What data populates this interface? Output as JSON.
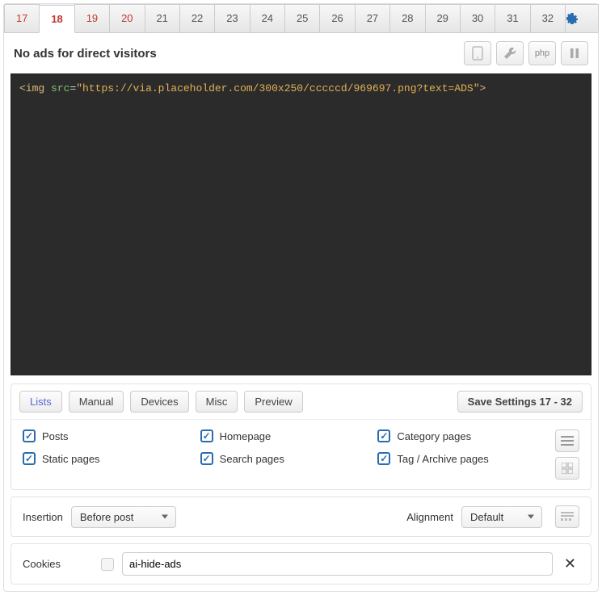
{
  "tabs": [
    "17",
    "18",
    "19",
    "20",
    "21",
    "22",
    "23",
    "24",
    "25",
    "26",
    "27",
    "28",
    "29",
    "30",
    "31",
    "32"
  ],
  "tabs_red": [
    0,
    1,
    2,
    3
  ],
  "active_tab": 1,
  "title": "No ads for direct visitors",
  "toolbar": {
    "php_label": "php"
  },
  "code_html": "<span class='t-tag'>&lt;img</span> <span class='t-attr'>src</span>=<span class='t-str'>\"https://via.placeholder.com/300x250/cccccd/969697.png?text=ADS\"</span><span class='t-tag'>&gt;</span>",
  "subtabs": {
    "lists": "Lists",
    "manual": "Manual",
    "devices": "Devices",
    "misc": "Misc",
    "preview": "Preview",
    "save": "Save Settings 17 - 32"
  },
  "checks": {
    "col1": [
      {
        "label": "Posts",
        "checked": true
      },
      {
        "label": "Static pages",
        "checked": true
      }
    ],
    "col2": [
      {
        "label": "Homepage",
        "checked": true
      },
      {
        "label": "Search pages",
        "checked": true
      }
    ],
    "col3": [
      {
        "label": "Category pages",
        "checked": true
      },
      {
        "label": "Tag / Archive pages",
        "checked": true
      }
    ]
  },
  "insertion": {
    "label": "Insertion",
    "value": "Before post"
  },
  "alignment": {
    "label": "Alignment",
    "value": "Default"
  },
  "cookies": {
    "label": "Cookies",
    "value": "ai-hide-ads"
  }
}
